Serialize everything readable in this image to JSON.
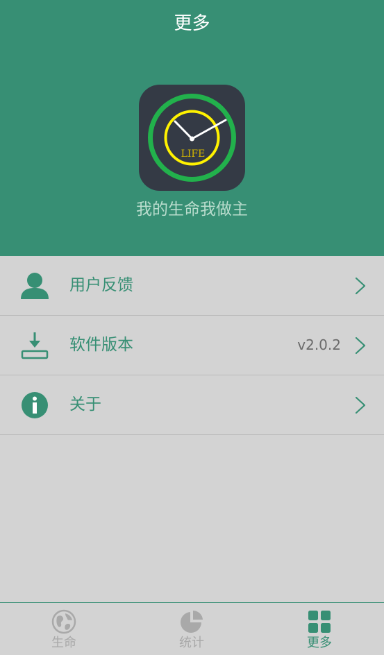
{
  "header": {
    "title": "更多",
    "slogan": "我的生命我做主",
    "app_icon_text": "LIFE",
    "app_icon": "life-clock-app-icon"
  },
  "menu": {
    "items": [
      {
        "label": "用户反馈",
        "value": "",
        "icon": "user-icon"
      },
      {
        "label": "软件版本",
        "value": "v2.0.2",
        "icon": "download-icon"
      },
      {
        "label": "关于",
        "value": "",
        "icon": "info-icon"
      }
    ],
    "chevron_icon": "chevron-right-icon"
  },
  "tabbar": {
    "tabs": [
      {
        "label": "生命",
        "icon": "globe-icon",
        "active": false
      },
      {
        "label": "统计",
        "icon": "pie-chart-icon",
        "active": false
      },
      {
        "label": "更多",
        "icon": "grid-icon",
        "active": true
      }
    ]
  },
  "colors": {
    "primary": "#378f74",
    "background": "#d3d3d3",
    "slogan": "#b9dccd",
    "inactive_tab": "#a9a9a9",
    "icon_ring_outer": "#22b14c",
    "icon_ring_inner": "#fff200"
  }
}
